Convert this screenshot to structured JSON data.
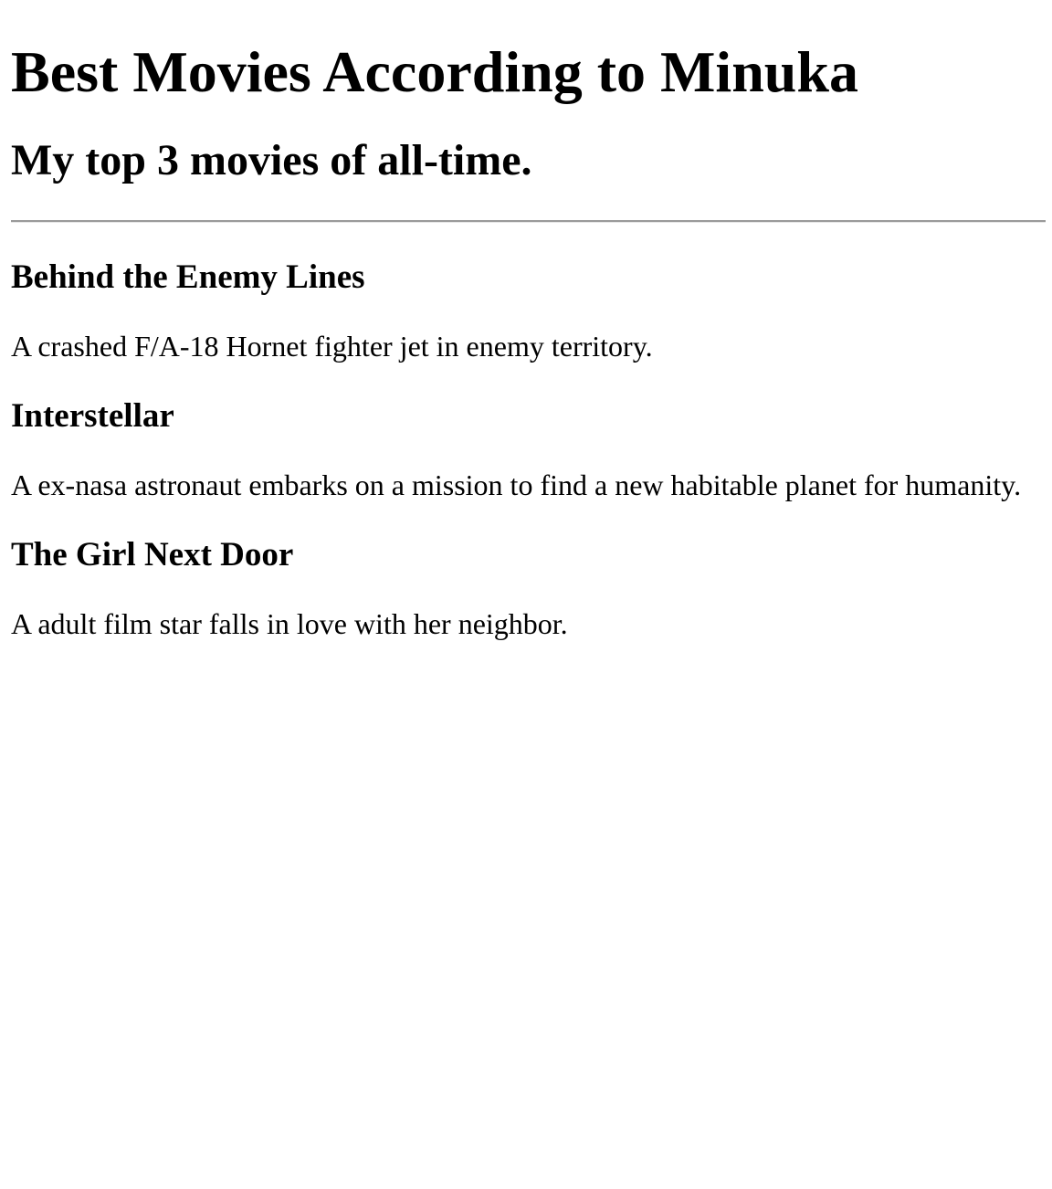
{
  "header": {
    "title": "Best Movies According to Minuka",
    "subtitle": "My top 3 movies of all-time."
  },
  "movies": [
    {
      "title": "Behind the Enemy Lines",
      "description": "A crashed F/A-18 Hornet fighter jet in enemy territory."
    },
    {
      "title": "Interstellar",
      "description": "A ex-nasa astronaut embarks on a mission to find a new habitable planet for humanity."
    },
    {
      "title": "The Girl Next Door",
      "description": "A adult film star falls in love with her neighbor."
    }
  ]
}
